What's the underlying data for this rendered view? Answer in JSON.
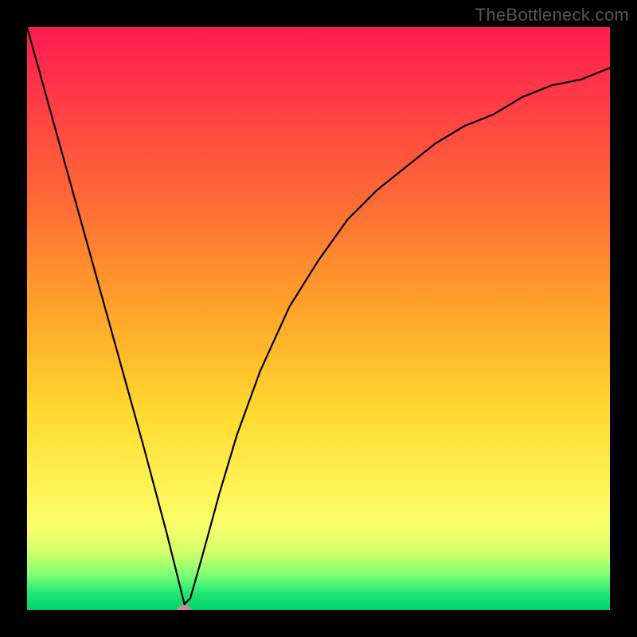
{
  "watermark": "TheBottleneck.com",
  "chart_data": {
    "type": "line",
    "title": "",
    "xlabel": "",
    "ylabel": "",
    "xlim": [
      0,
      100
    ],
    "ylim": [
      0,
      100
    ],
    "background_scale": "red (top) → yellow → green (bottom)",
    "series": [
      {
        "name": "curve",
        "x": [
          0,
          5,
          10,
          15,
          20,
          24,
          26,
          27,
          28,
          30,
          33,
          36,
          40,
          45,
          50,
          55,
          60,
          65,
          70,
          75,
          80,
          85,
          90,
          95,
          100
        ],
        "values": [
          100,
          82,
          64,
          46,
          28,
          13,
          5,
          1,
          2,
          9,
          20,
          30,
          41,
          52,
          60,
          67,
          72,
          76,
          80,
          83,
          85,
          88,
          90,
          91,
          93
        ]
      }
    ],
    "marker": {
      "x": 27,
      "y": 0,
      "color": "#d08a8a"
    }
  }
}
